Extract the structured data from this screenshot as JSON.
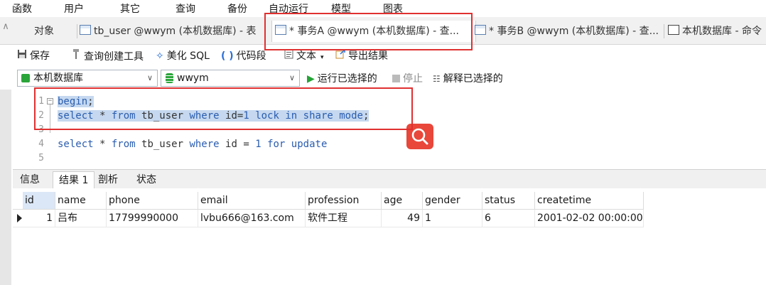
{
  "menu": [
    "函数",
    "用户",
    "其它",
    "查询",
    "备份",
    "自动运行",
    "模型",
    "图表"
  ],
  "tabs": [
    {
      "label": "对象"
    },
    {
      "label": "tb_user @wwym (本机数据库) - 表"
    },
    {
      "label": "* 事务A @wwym (本机数据库) - 查..."
    },
    {
      "label": "* 事务B @wwym (本机数据库) - 查..."
    },
    {
      "label": "本机数据库 - 命令"
    }
  ],
  "toolbar": {
    "save": "保存",
    "query_builder": "查询创建工具",
    "beautify": "美化 SQL",
    "snippet": "代码段",
    "text": "文本",
    "export": "导出结果"
  },
  "connection": {
    "database_combo": "本机数据库",
    "schema_combo": "wwym",
    "run_selected": "运行已选择的",
    "stop": "停止",
    "explain_selected": "解释已选择的"
  },
  "editor": {
    "line_numbers": [
      "1",
      "2",
      "3",
      "4",
      "5"
    ],
    "lines": [
      {
        "a": "begin",
        "b": ";"
      },
      {
        "a": "select",
        "b": " * ",
        "c": "from",
        "d": " tb_user ",
        "e": "where",
        "f": " id=",
        "g": "1",
        "h": " ",
        "i": "lock",
        "j": " ",
        "k": "in",
        "l": " ",
        "m": "share",
        "n": " ",
        "o": "mode",
        "p": ";"
      },
      {},
      {
        "a": "select",
        "b": " * ",
        "c": "from",
        "d": " tb_user ",
        "e": "where",
        "f": " id = ",
        "g": "1",
        "h": " ",
        "i": "for",
        "j": " ",
        "k": "update"
      },
      {}
    ]
  },
  "result_tabs": [
    "信息",
    "结果 1",
    "剖析",
    "状态"
  ],
  "grid": {
    "columns": [
      "id",
      "name",
      "phone",
      "email",
      "profession",
      "age",
      "gender",
      "status",
      "createtime"
    ],
    "rows": [
      [
        "1",
        "吕布",
        "17799990000",
        "lvbu666@163.com",
        "软件工程",
        "49",
        "1",
        "6",
        "2001-02-02 00:00:00"
      ]
    ]
  },
  "colors": {
    "highlight_box": "#e03030",
    "selection": "#c5d8ef",
    "keyword": "#2a5db0",
    "search_button": "#e8473a"
  },
  "icons": [
    "save-icon",
    "query-builder-icon",
    "magic-wand-icon",
    "code-snippet-icon",
    "text-icon",
    "export-icon",
    "database-icon",
    "schema-icon",
    "play-icon",
    "stop-icon",
    "explain-icon",
    "search-icon",
    "table-icon",
    "query-icon",
    "command-icon"
  ]
}
